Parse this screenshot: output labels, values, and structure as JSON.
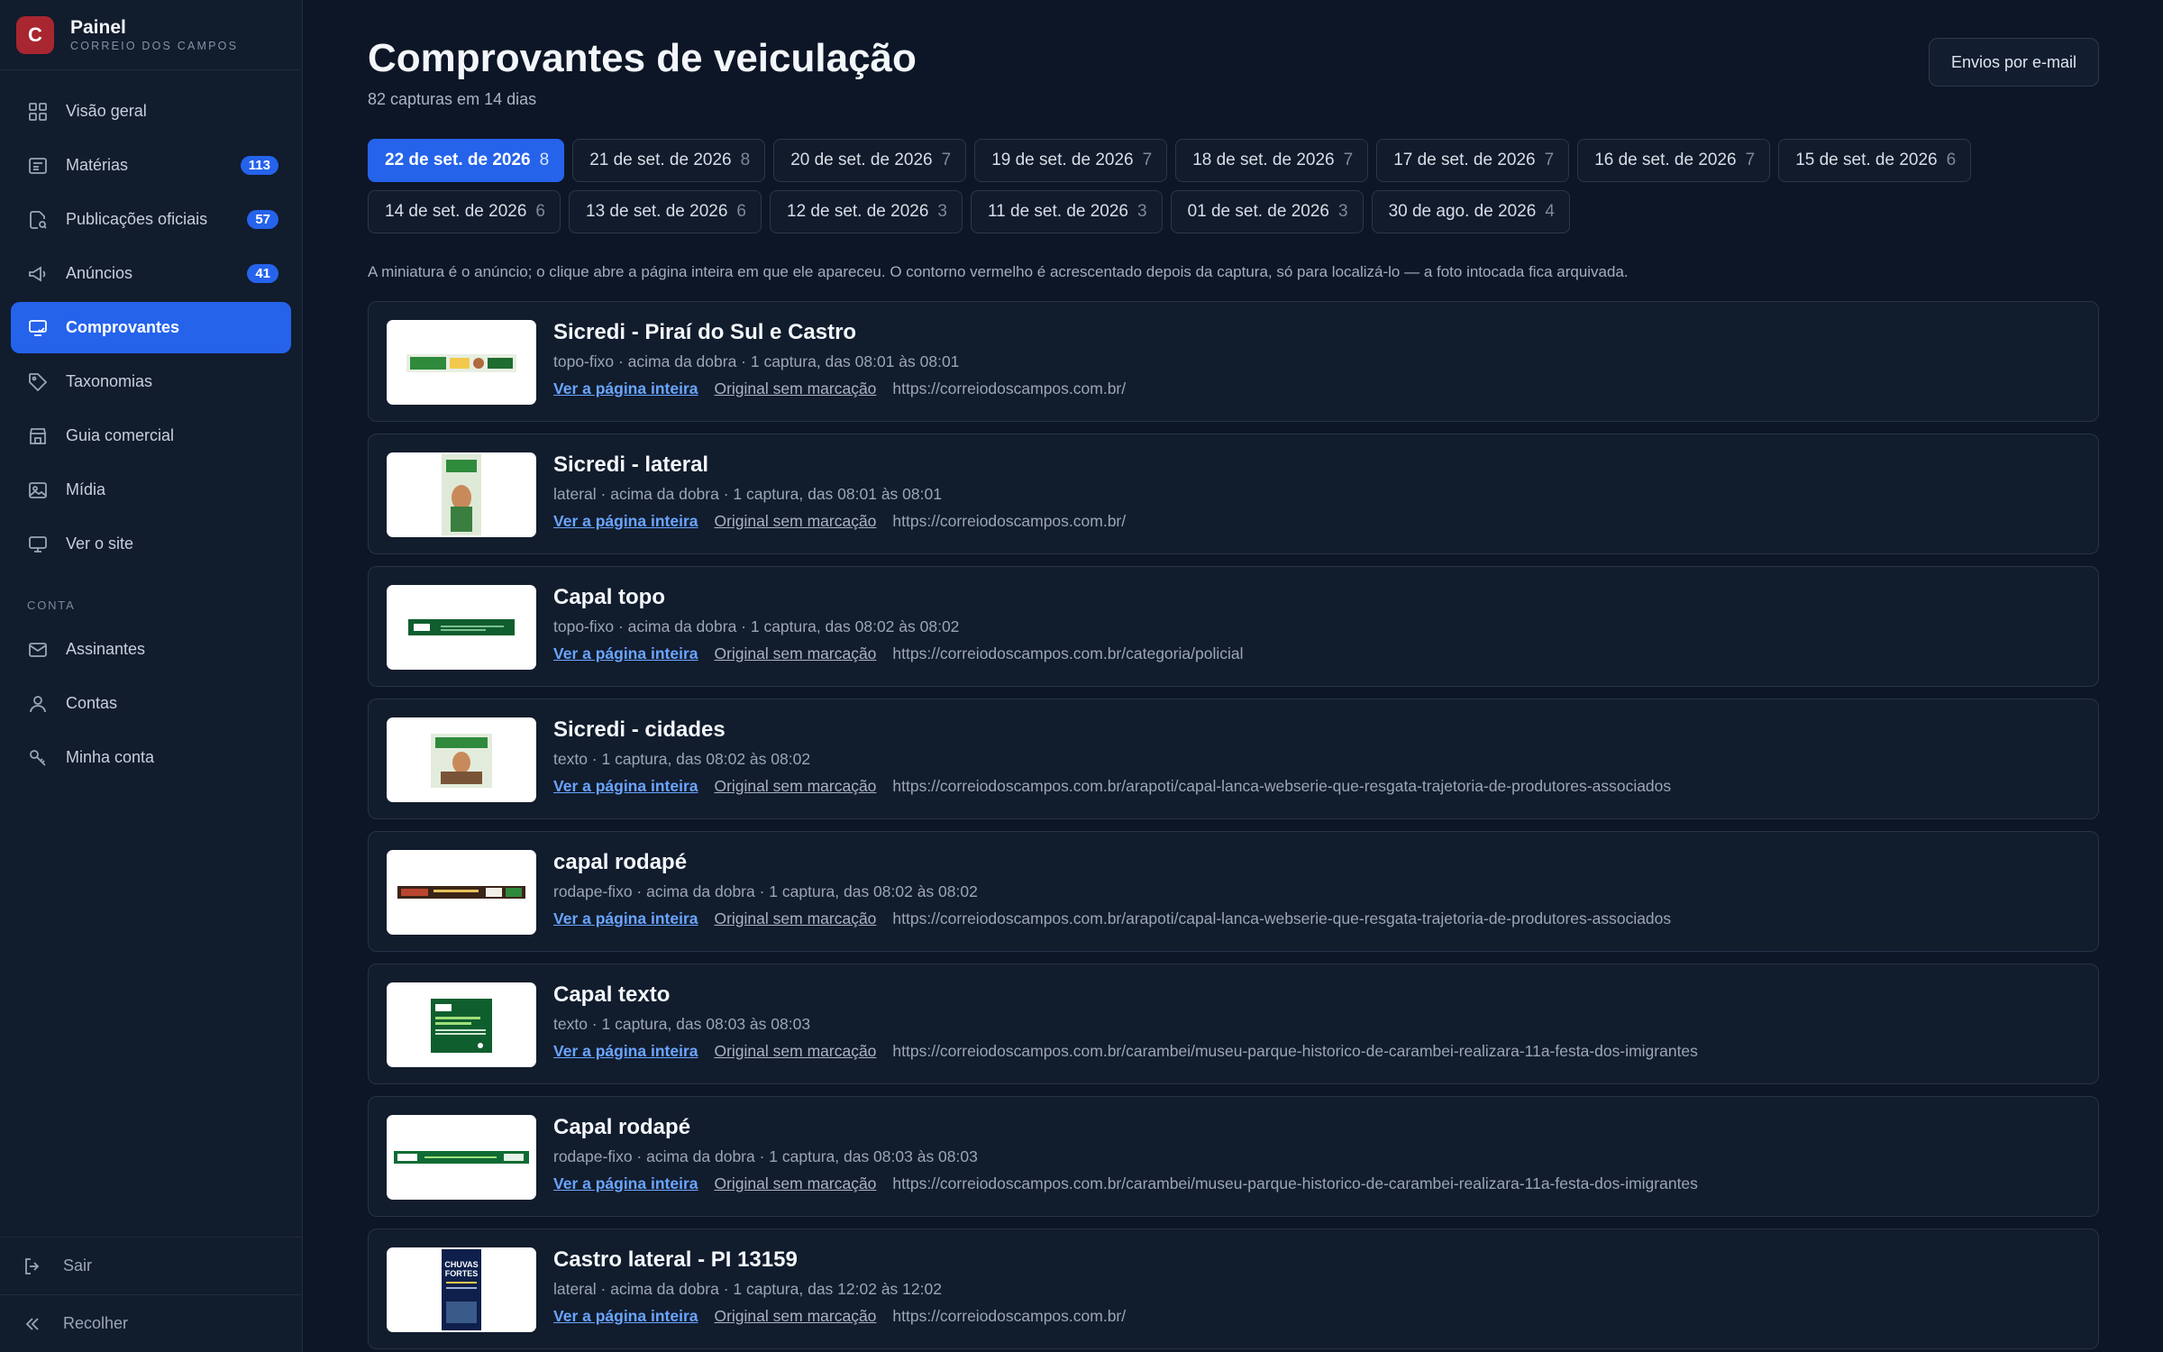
{
  "brand": {
    "logo_letter": "C",
    "title": "Painel",
    "subtitle": "CORREIO DOS CAMPOS",
    "color": "#a8262f"
  },
  "nav": {
    "items": [
      {
        "label": "Visão geral",
        "icon": "grid-icon"
      },
      {
        "label": "Matérias",
        "icon": "newspaper-icon",
        "badge": "113"
      },
      {
        "label": "Publicações oficiais",
        "icon": "document-search-icon",
        "badge": "57"
      },
      {
        "label": "Anúncios",
        "icon": "megaphone-icon",
        "badge": "41"
      },
      {
        "label": "Comprovantes",
        "icon": "screen-check-icon",
        "active": true
      },
      {
        "label": "Taxonomias",
        "icon": "tag-icon"
      },
      {
        "label": "Guia comercial",
        "icon": "store-icon"
      },
      {
        "label": "Mídia",
        "icon": "image-icon"
      },
      {
        "label": "Ver o site",
        "icon": "monitor-icon"
      }
    ],
    "section_label": "CONTA",
    "account_items": [
      {
        "label": "Assinantes",
        "icon": "mail-icon"
      },
      {
        "label": "Contas",
        "icon": "user-icon"
      },
      {
        "label": "Minha conta",
        "icon": "key-icon"
      }
    ],
    "logout": "Sair",
    "collapse": "Recolher"
  },
  "header": {
    "title": "Comprovantes de veiculação",
    "subtitle": "82 capturas em 14 dias",
    "email_button": "Envios por e-mail"
  },
  "dates": [
    {
      "label": "22 de set. de 2026",
      "count": "8",
      "active": true
    },
    {
      "label": "21 de set. de 2026",
      "count": "8"
    },
    {
      "label": "20 de set. de 2026",
      "count": "7"
    },
    {
      "label": "19 de set. de 2026",
      "count": "7"
    },
    {
      "label": "18 de set. de 2026",
      "count": "7"
    },
    {
      "label": "17 de set. de 2026",
      "count": "7"
    },
    {
      "label": "16 de set. de 2026",
      "count": "7"
    },
    {
      "label": "15 de set. de 2026",
      "count": "6"
    },
    {
      "label": "14 de set. de 2026",
      "count": "6"
    },
    {
      "label": "13 de set. de 2026",
      "count": "6"
    },
    {
      "label": "12 de set. de 2026",
      "count": "3"
    },
    {
      "label": "11 de set. de 2026",
      "count": "3"
    },
    {
      "label": "01 de set. de 2026",
      "count": "3"
    },
    {
      "label": "30 de ago. de 2026",
      "count": "4"
    }
  ],
  "note": "A miniatura é o anúncio; o clique abre a página inteira em que ele apareceu. O contorno vermelho é acrescentado depois da captura, só para localizá-lo — a foto intocada fica arquivada.",
  "links": {
    "full_page": "Ver a página inteira",
    "original": "Original sem marcação"
  },
  "captures": [
    {
      "title": "Sicredi - Piraí do Sul e Castro",
      "meta": "topo-fixo · acima da dobra · 1 captura, das 08:01 às 08:01",
      "url": "https://correiodoscampos.com.br/",
      "thumb": "banner-wide"
    },
    {
      "title": "Sicredi - lateral",
      "meta": "lateral · acima da dobra · 1 captura, das 08:01 às 08:01",
      "url": "https://correiodoscampos.com.br/",
      "thumb": "vertical"
    },
    {
      "title": "Capal topo",
      "meta": "topo-fixo · acima da dobra · 1 captura, das 08:02 às 08:02",
      "url": "https://correiodoscampos.com.br/categoria/policial",
      "thumb": "green-strip"
    },
    {
      "title": "Sicredi - cidades",
      "meta": "texto · 1 captura, das 08:02 às 08:02",
      "url": "https://correiodoscampos.com.br/arapoti/capal-lanca-webserie-que-resgata-trajetoria-de-produtores-associados",
      "thumb": "square-photo"
    },
    {
      "title": "capal rodapé",
      "meta": "rodape-fixo · acima da dobra · 1 captura, das 08:02 às 08:02",
      "url": "https://correiodoscampos.com.br/arapoti/capal-lanca-webserie-que-resgata-trajetoria-de-produtores-associados",
      "thumb": "dark-strip"
    },
    {
      "title": "Capal texto",
      "meta": "texto · 1 captura, das 08:03 às 08:03",
      "url": "https://correiodoscampos.com.br/carambei/museu-parque-historico-de-carambei-realizara-11a-festa-dos-imigrantes",
      "thumb": "green-square"
    },
    {
      "title": "Capal rodapé",
      "meta": "rodape-fixo · acima da dobra · 1 captura, das 08:03 às 08:03",
      "url": "https://correiodoscampos.com.br/carambei/museu-parque-historico-de-carambei-realizara-11a-festa-dos-imigrantes",
      "thumb": "green-long"
    },
    {
      "title": "Castro lateral - PI 13159",
      "meta": "lateral · acima da dobra · 1 captura, das 12:02 às 12:02",
      "url": "https://correiodoscampos.com.br/",
      "thumb": "poster"
    }
  ],
  "thumb_text": {
    "poster_line1": "CHUVAS",
    "poster_line2": "FORTES"
  },
  "colors": {
    "accent": "#2563eb",
    "background": "#0d1626",
    "sidebar": "#111c2d"
  }
}
